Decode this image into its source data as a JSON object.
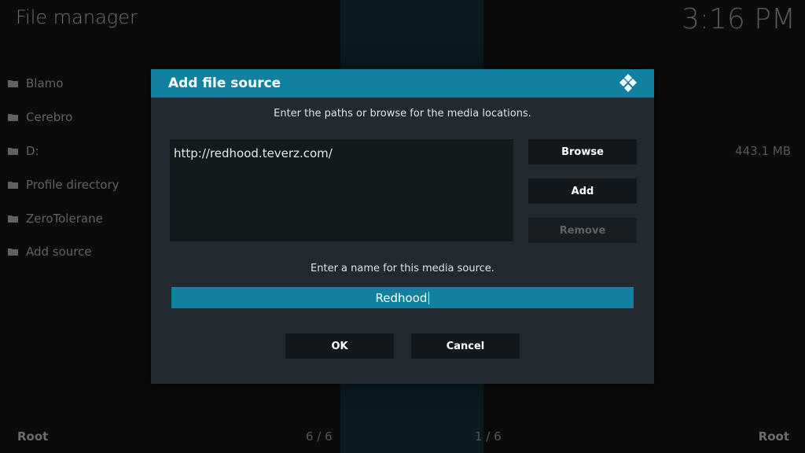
{
  "app": {
    "title": "File manager",
    "clock": "3:16 PM"
  },
  "sources": [
    {
      "label": "Blamo",
      "icon": "folder-icon"
    },
    {
      "label": "Cerebro",
      "icon": "folder-icon"
    },
    {
      "label": "D:",
      "icon": "folder-icon"
    },
    {
      "label": "Profile directory",
      "icon": "folder-icon"
    },
    {
      "label": "ZeroTolerane",
      "icon": "folder-icon"
    },
    {
      "label": "Add source",
      "icon": "folder-icon"
    }
  ],
  "right_panel": {
    "drive_size": "443.1 MB"
  },
  "footer": {
    "left": "Root",
    "right": "Root",
    "left_count": "6 / 6",
    "right_count": "1 / 6"
  },
  "dialog": {
    "title": "Add file source",
    "instruction_paths": "Enter the paths or browse for the media locations.",
    "path_value": "http://redhood.teverz.com/",
    "browse_label": "Browse",
    "add_label": "Add",
    "remove_label": "Remove",
    "instruction_name": "Enter a name for this media source.",
    "name_value": "Redhood",
    "ok_label": "OK",
    "cancel_label": "Cancel"
  },
  "colors": {
    "accent": "#12819f",
    "dialog_bg": "#212a30",
    "background": "#0b0b0c"
  }
}
